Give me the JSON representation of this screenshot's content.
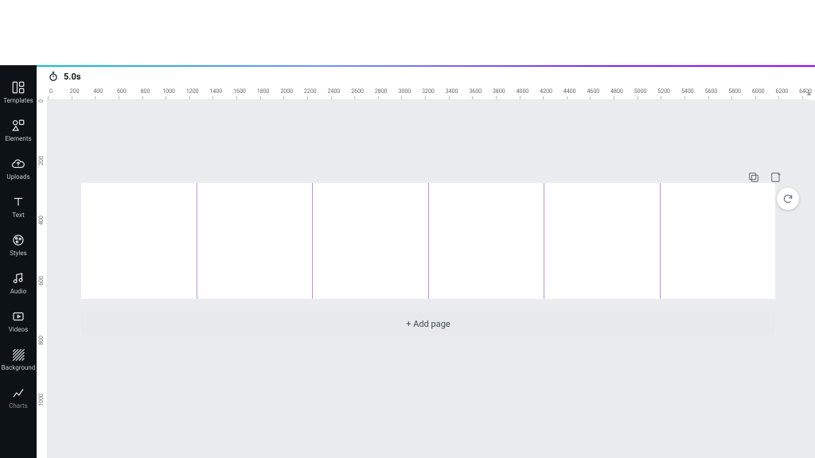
{
  "duration": "5.0s",
  "sidebar": {
    "items": [
      {
        "label": "Templates"
      },
      {
        "label": "Elements"
      },
      {
        "label": "Uploads"
      },
      {
        "label": "Text"
      },
      {
        "label": "Styles"
      },
      {
        "label": "Audio"
      },
      {
        "label": "Videos"
      },
      {
        "label": "Background"
      },
      {
        "label": "Charts"
      }
    ]
  },
  "ruler": {
    "h_ticks": [
      "0",
      "200",
      "400",
      "600",
      "800",
      "1000",
      "1200",
      "1400",
      "1600",
      "1800",
      "2000",
      "2200",
      "2400",
      "2600",
      "2800",
      "3000",
      "3200",
      "3400",
      "3600",
      "3800",
      "4000",
      "4200",
      "4400",
      "4600",
      "4800",
      "5000",
      "5200",
      "5400",
      "5600",
      "5800",
      "6000",
      "6200",
      "6400"
    ],
    "v_ticks": [
      "0",
      "200",
      "400",
      "600",
      "800",
      "1000"
    ]
  },
  "pages": {
    "count": 6
  },
  "add_page_label": "+ Add page"
}
